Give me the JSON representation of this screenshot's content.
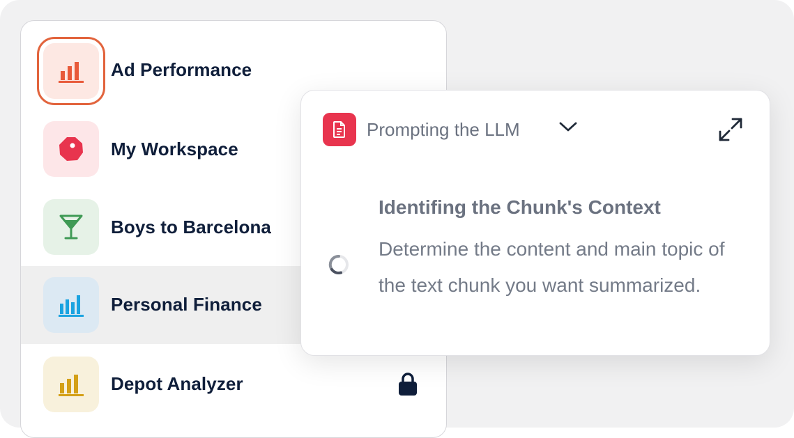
{
  "workspaces": [
    {
      "label": "Ad Performance",
      "icon": "bar-chart-icon",
      "icon_color": "#e85a3a",
      "bg": "#fde8e3",
      "active": true
    },
    {
      "label": "My Workspace",
      "icon": "octagon-target-icon",
      "icon_color": "#e8344e",
      "bg": "#fde6e8"
    },
    {
      "label": "Boys to Barcelona",
      "icon": "cocktail-glass-icon",
      "icon_color": "#3f9a55",
      "bg": "#e6f2e7"
    },
    {
      "label": "Personal Finance",
      "icon": "bar-chart-icon",
      "icon_color": "#1aa3e0",
      "bg": "#dce9f3",
      "selected": true
    },
    {
      "label": "Depot Analyzer",
      "icon": "bar-chart-icon",
      "icon_color": "#d4a017",
      "bg": "#f8f1dc",
      "locked": true
    }
  ],
  "step_card": {
    "title": "Prompting the LLM",
    "badge_icon": "document-icon",
    "badge_color": "#e8344e",
    "heading": "Identifing the Chunk's Context",
    "description": "Determine the content and main topic of the text chunk you want summarized."
  }
}
